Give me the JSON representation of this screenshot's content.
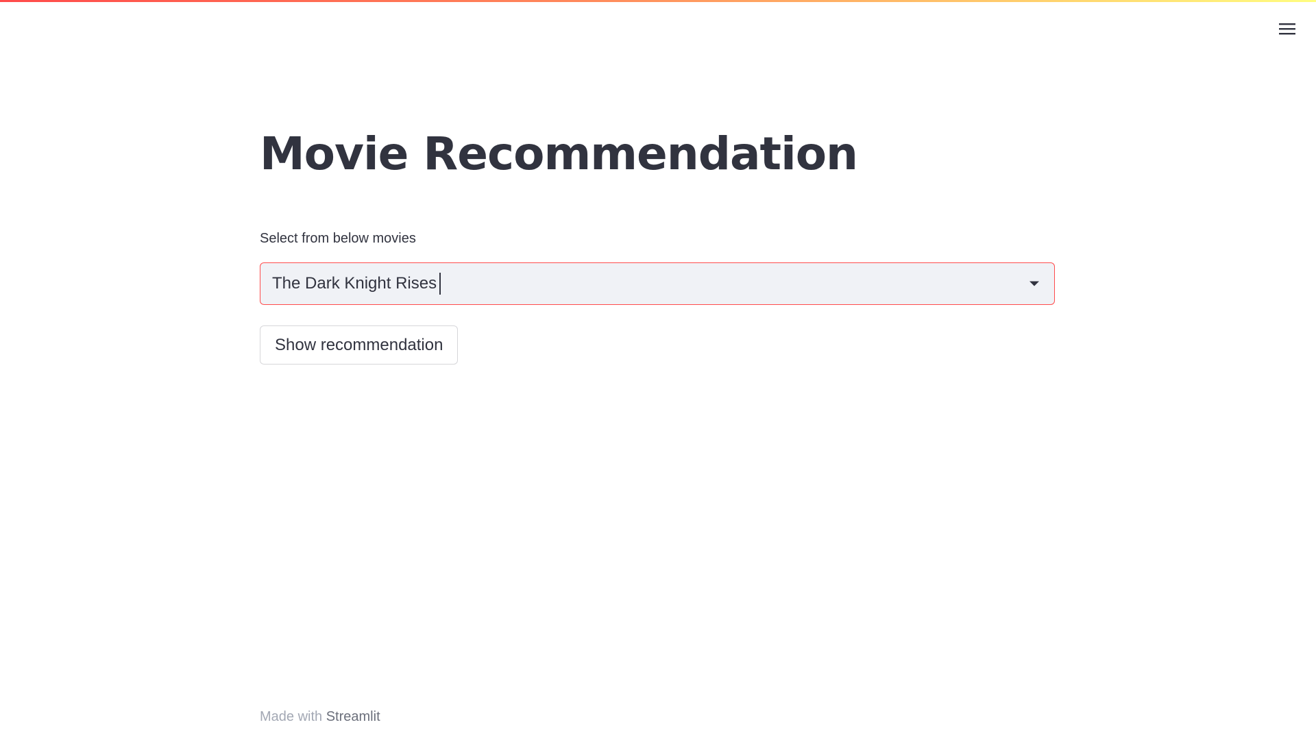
{
  "header": {
    "decoration_colors": [
      "#ff4b4b",
      "#fffd80"
    ],
    "menu_icon": "hamburger-menu-icon"
  },
  "main": {
    "title": "Movie Recommendation",
    "select": {
      "label": "Select from below movies",
      "value": "The Dark Knight Rises",
      "arrow_icon": "dropdown-arrow-icon",
      "focused": true,
      "accent_color": "#ff4b4b"
    },
    "button_label": "Show recommendation"
  },
  "footer": {
    "prefix": "Made with",
    "brand": "Streamlit"
  }
}
